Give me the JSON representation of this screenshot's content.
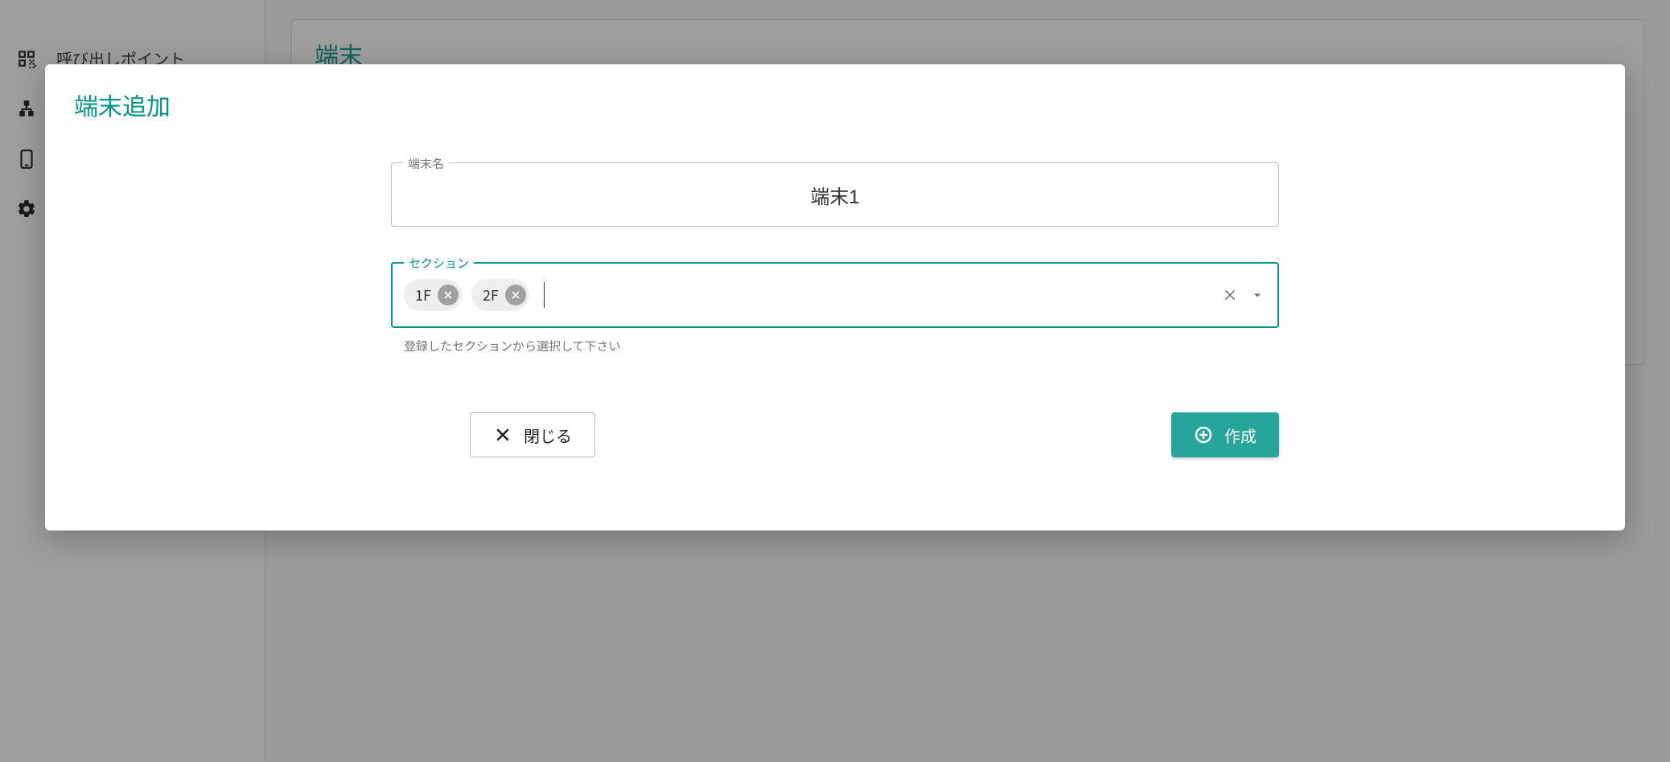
{
  "colors": {
    "accent": "#009688",
    "accent_btn": "#26a69a"
  },
  "sidebar": {
    "items": [
      {
        "label": "呼び出しポイント"
      }
    ]
  },
  "main": {
    "title": "端末"
  },
  "modal": {
    "title": "端末追加",
    "terminal_name": {
      "label": "端末名",
      "value": "端末1"
    },
    "section": {
      "label": "セクション",
      "chips": [
        "1F",
        "2F"
      ],
      "helper": "登録したセクションから選択して下さい"
    },
    "close_label": "閉じる",
    "create_label": "作成"
  }
}
